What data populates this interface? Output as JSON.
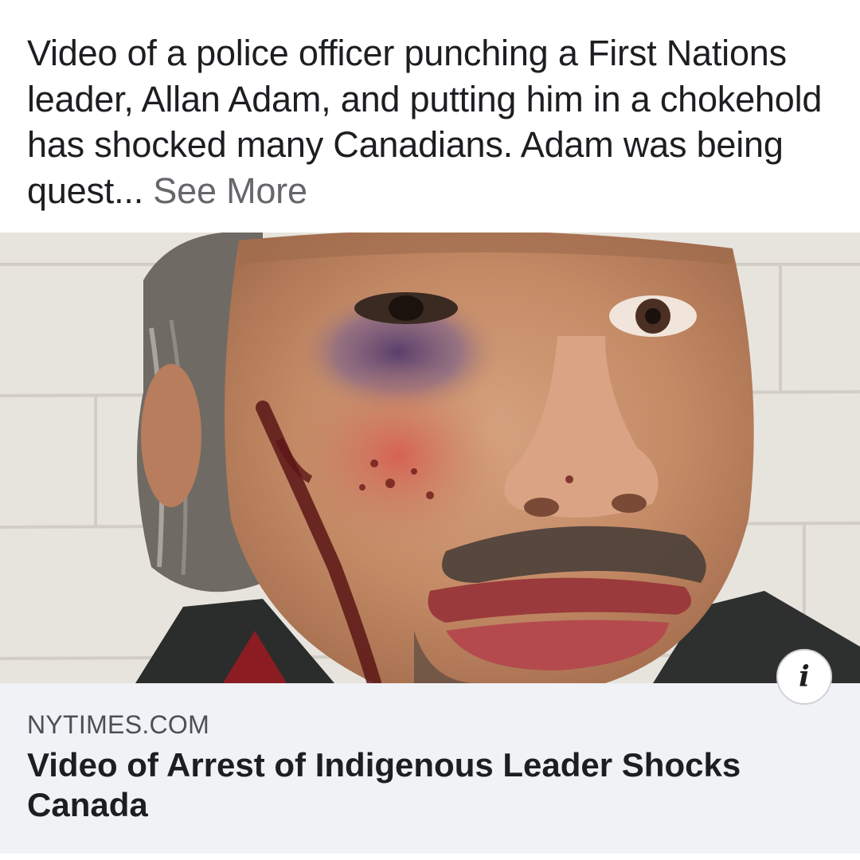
{
  "post": {
    "caption_text": "Video of a police officer punching a First Nations leader, Allan Adam, and putting him in a chokehold has shocked many Canadians. Adam was being quest...",
    "see_more_label": "See More"
  },
  "photo": {
    "description_icon": "info-icon",
    "info_glyph": "i"
  },
  "link_preview": {
    "domain": "NYTIMES.COM",
    "title": "Video of Arrest of Indigenous Leader Shocks Canada"
  },
  "colors": {
    "text_primary": "#1c1e21",
    "text_secondary": "#65676b",
    "link_box_bg": "#f0f2f5"
  }
}
